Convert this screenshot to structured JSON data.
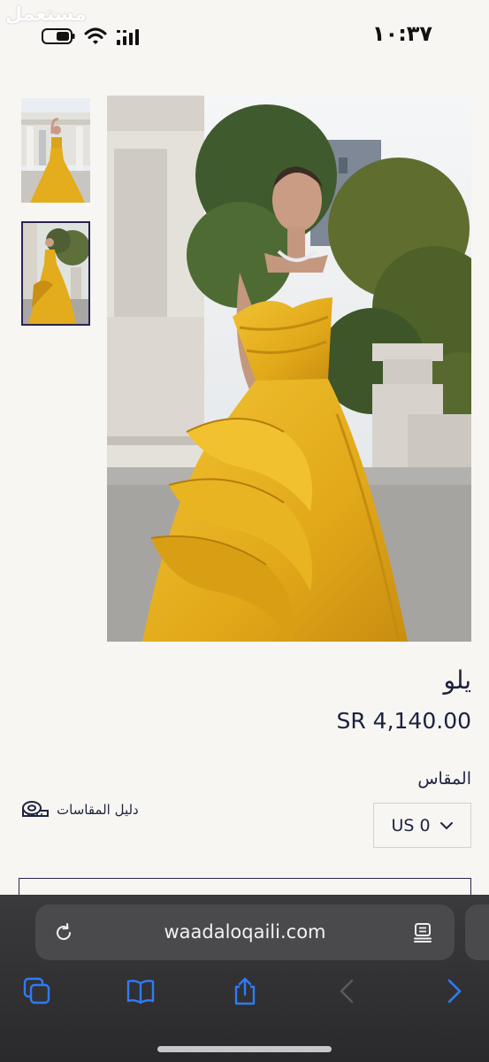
{
  "status_bar": {
    "watermark": "مستعمل",
    "time": "١٠:٣٧"
  },
  "product": {
    "title": "يلو",
    "price": "SR 4,140.00",
    "size_label": "المقاس",
    "size_guide": "دليل المقاسات",
    "selected_size": "US 0"
  },
  "browser": {
    "url": "waadaloqaili.com"
  },
  "colors": {
    "accent": "#2a2350",
    "link_blue": "#2f7bf6",
    "dress": "#e2ac1c"
  }
}
